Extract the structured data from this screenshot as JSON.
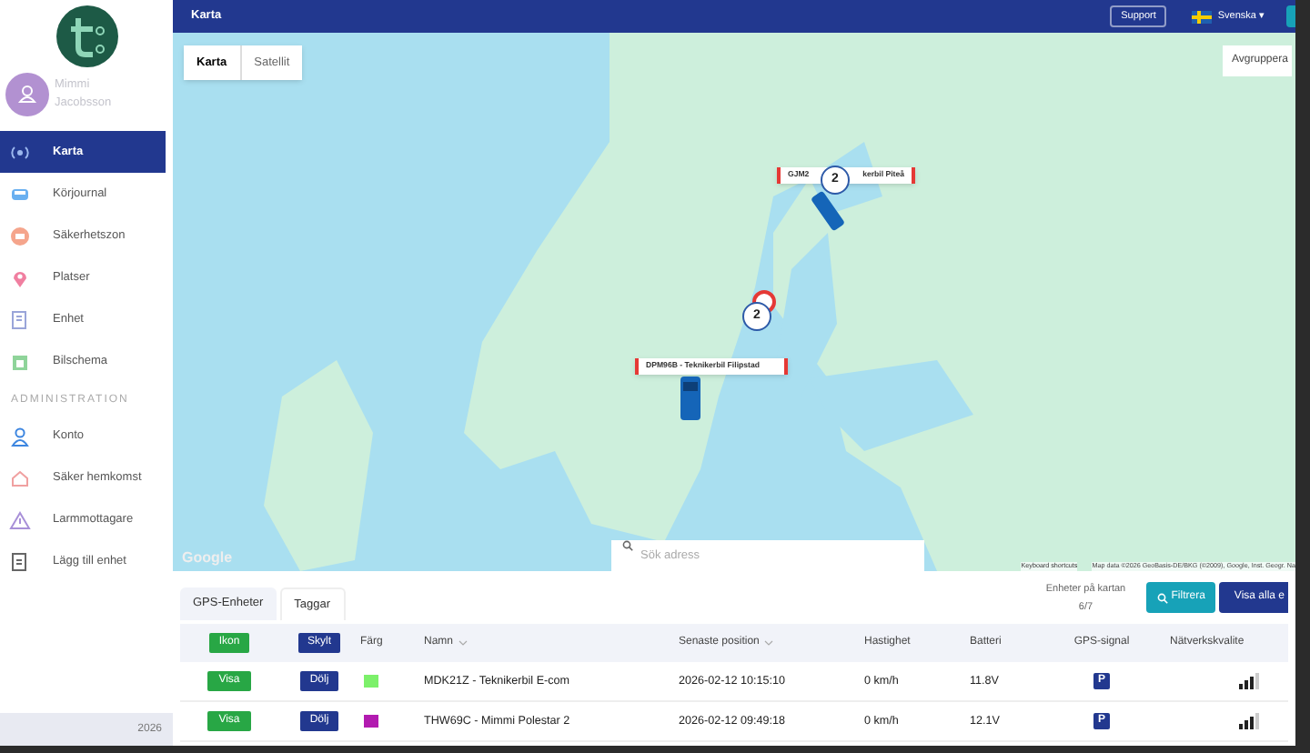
{
  "header": {
    "title": "Karta",
    "support": "Support",
    "language": "Svenska ▾"
  },
  "user": {
    "name": "Mimmi Jacobsson"
  },
  "sidebar": {
    "items": [
      {
        "label": "Karta",
        "selected": true
      },
      {
        "label": "Körjournal",
        "selected": false
      },
      {
        "label": "Säkerhetszon",
        "selected": false
      },
      {
        "label": "Platser",
        "selected": false
      },
      {
        "label": "Enhet",
        "selected": false
      },
      {
        "label": "Bilschema",
        "selected": false
      }
    ],
    "section": "ADMINISTRATION",
    "admin_items": [
      {
        "label": "Konto",
        "selected": false
      },
      {
        "label": "Säker hemkomst",
        "selected": false
      },
      {
        "label": "Larmmottagare",
        "selected": false
      },
      {
        "label": "Lägg till enhet",
        "selected": false
      }
    ],
    "footer": "2026"
  },
  "map": {
    "map_types": [
      {
        "label": "Karta",
        "selected": true
      },
      {
        "label": "Satellit",
        "selected": false
      }
    ],
    "ungroup": "Avgruppera",
    "markers": [
      {
        "label_parts": [
          "GJM2",
          "kerbil Piteå"
        ]
      },
      {
        "label_parts": [
          "DPM96B - Teknikerbil Filipstad"
        ]
      }
    ],
    "clusters": [
      "2",
      "2"
    ],
    "search": {
      "placeholder": "Sök adress"
    },
    "logo": "Google",
    "keyboard_shortcuts": "Keyboard shortcuts",
    "attribution": "Map data ©2026 GeoBasis-DE/BKG (©2009), Google, Inst. Geogr. Na"
  },
  "panel": {
    "tabs": [
      {
        "label": "GPS-Enheter",
        "selected": true
      },
      {
        "label": "Taggar",
        "selected": false
      }
    ],
    "count_label": "Enheter på kartan",
    "count": "6/7",
    "filter": "Filtrera",
    "show_all": "Visa alla e"
  },
  "table": {
    "columns": [
      "Ikon",
      "Skylt",
      "Färg",
      "Namn",
      "Senaste position",
      "Hastighet",
      "Batteri",
      "GPS-signal",
      "Nätverkskvalite"
    ],
    "rows": [
      {
        "icon": "Visa",
        "plate": "Dölj",
        "color": "#7cf06a",
        "name": "MDK21Z - Teknikerbil E-com",
        "last_position": "2026-02-12 10:15:10",
        "speed": "0 km/h",
        "battery": "11.8V",
        "gps": "P"
      },
      {
        "icon": "Visa",
        "plate": "Dölj",
        "color": "#b21bb0",
        "name": "THW69C - Mimmi Polestar 2",
        "last_position": "2026-02-12 09:49:18",
        "speed": "0 km/h",
        "battery": "12.1V",
        "gps": "P"
      }
    ]
  }
}
